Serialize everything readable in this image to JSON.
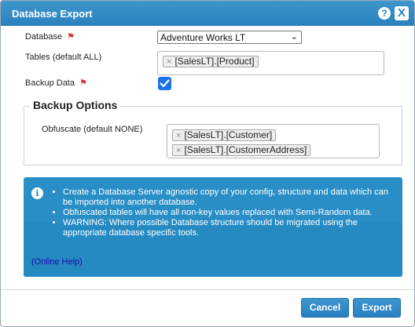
{
  "window": {
    "title": "Database Export",
    "help_label": "?",
    "close_label": "X"
  },
  "form": {
    "database_label": "Database",
    "database_value": "Adventure Works LT",
    "tables_label": "Tables (default ALL)",
    "tables_selected": [
      "[SalesLT].[Product]"
    ],
    "backup_data_label": "Backup Data",
    "backup_data_checked": true
  },
  "backup_options": {
    "title": "Backup Options",
    "obfuscate_label": "Obfuscate (default NONE)",
    "obfuscate_selected": [
      "[SalesLT].[Customer]",
      "[SalesLT].[CustomerAddress]"
    ]
  },
  "info": {
    "items": [
      "Create a Database Server agnostic copy of your config, structure and data which can be imported into another database.",
      "Obfuscated tables will have all non-key values replaced with Semi-Random data.",
      "WARNING: Where possible Database structure should be migrated using the appropriate database specific tools."
    ],
    "help_link": "(Online Help)"
  },
  "buttons": {
    "cancel": "Cancel",
    "export": "Export"
  },
  "chip_remove_glyph": "×",
  "required_flag_icon": "flag-icon",
  "colors": {
    "titlebar": "#2a80bd",
    "info_background": "#2a8ec6",
    "checkbox": "#1a73e8",
    "required_flag": "#dd3333"
  }
}
